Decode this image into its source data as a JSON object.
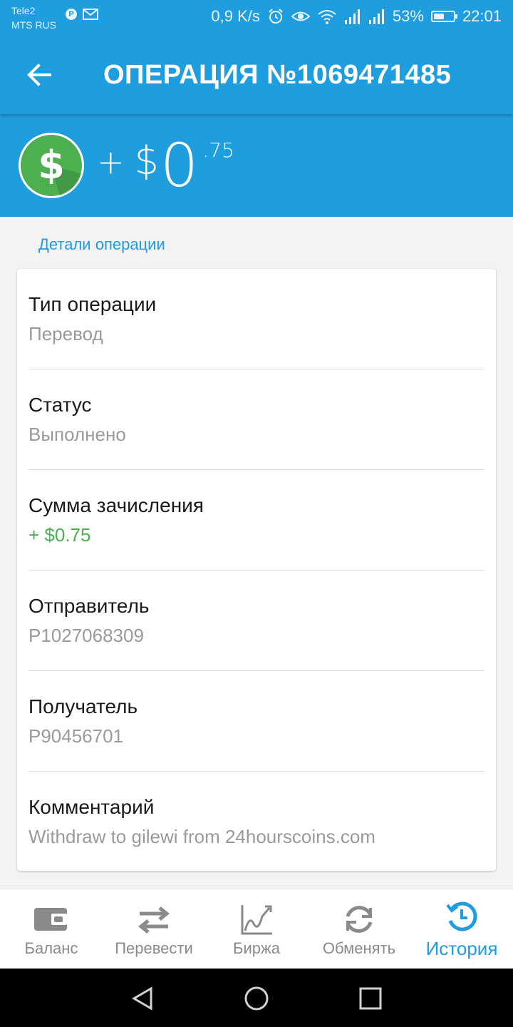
{
  "status_bar": {
    "carrier1": "Tele2",
    "carrier2": "MTS RUS",
    "p_badge": "P",
    "speed": "0,9 K/s",
    "battery_text": "53%",
    "battery_level": 0.53,
    "time": "22:01"
  },
  "app_bar": {
    "title": "ОПЕРАЦИЯ №1069471485"
  },
  "hero": {
    "sign": "+",
    "currency": "$",
    "integer": "0",
    "fraction": ".75",
    "coin_color": "#4caf50"
  },
  "details": {
    "section_title": "Детали операции",
    "rows": [
      {
        "label": "Тип операции",
        "value": "Перевод"
      },
      {
        "label": "Статус",
        "value": "Выполнено"
      },
      {
        "label": "Сумма зачисления",
        "value": "+ $0.75"
      },
      {
        "label": "Отправитель",
        "value": "P1027068309"
      },
      {
        "label": "Получатель",
        "value": "P90456701"
      },
      {
        "label": "Комментарий",
        "value": "Withdraw to gilewi from 24hourscoins.com"
      }
    ]
  },
  "bottom_nav": {
    "items": [
      {
        "label": "Баланс",
        "icon": "wallet-icon"
      },
      {
        "label": "Перевести",
        "icon": "transfer-arrows-icon"
      },
      {
        "label": "Биржа",
        "icon": "chart-icon"
      },
      {
        "label": "Обменять",
        "icon": "exchange-icon"
      },
      {
        "label": "История",
        "icon": "history-icon"
      }
    ],
    "active": "История"
  },
  "colors": {
    "primary": "#1e9ddf",
    "positive": "#4caf50",
    "muted": "#9a9a9a"
  }
}
